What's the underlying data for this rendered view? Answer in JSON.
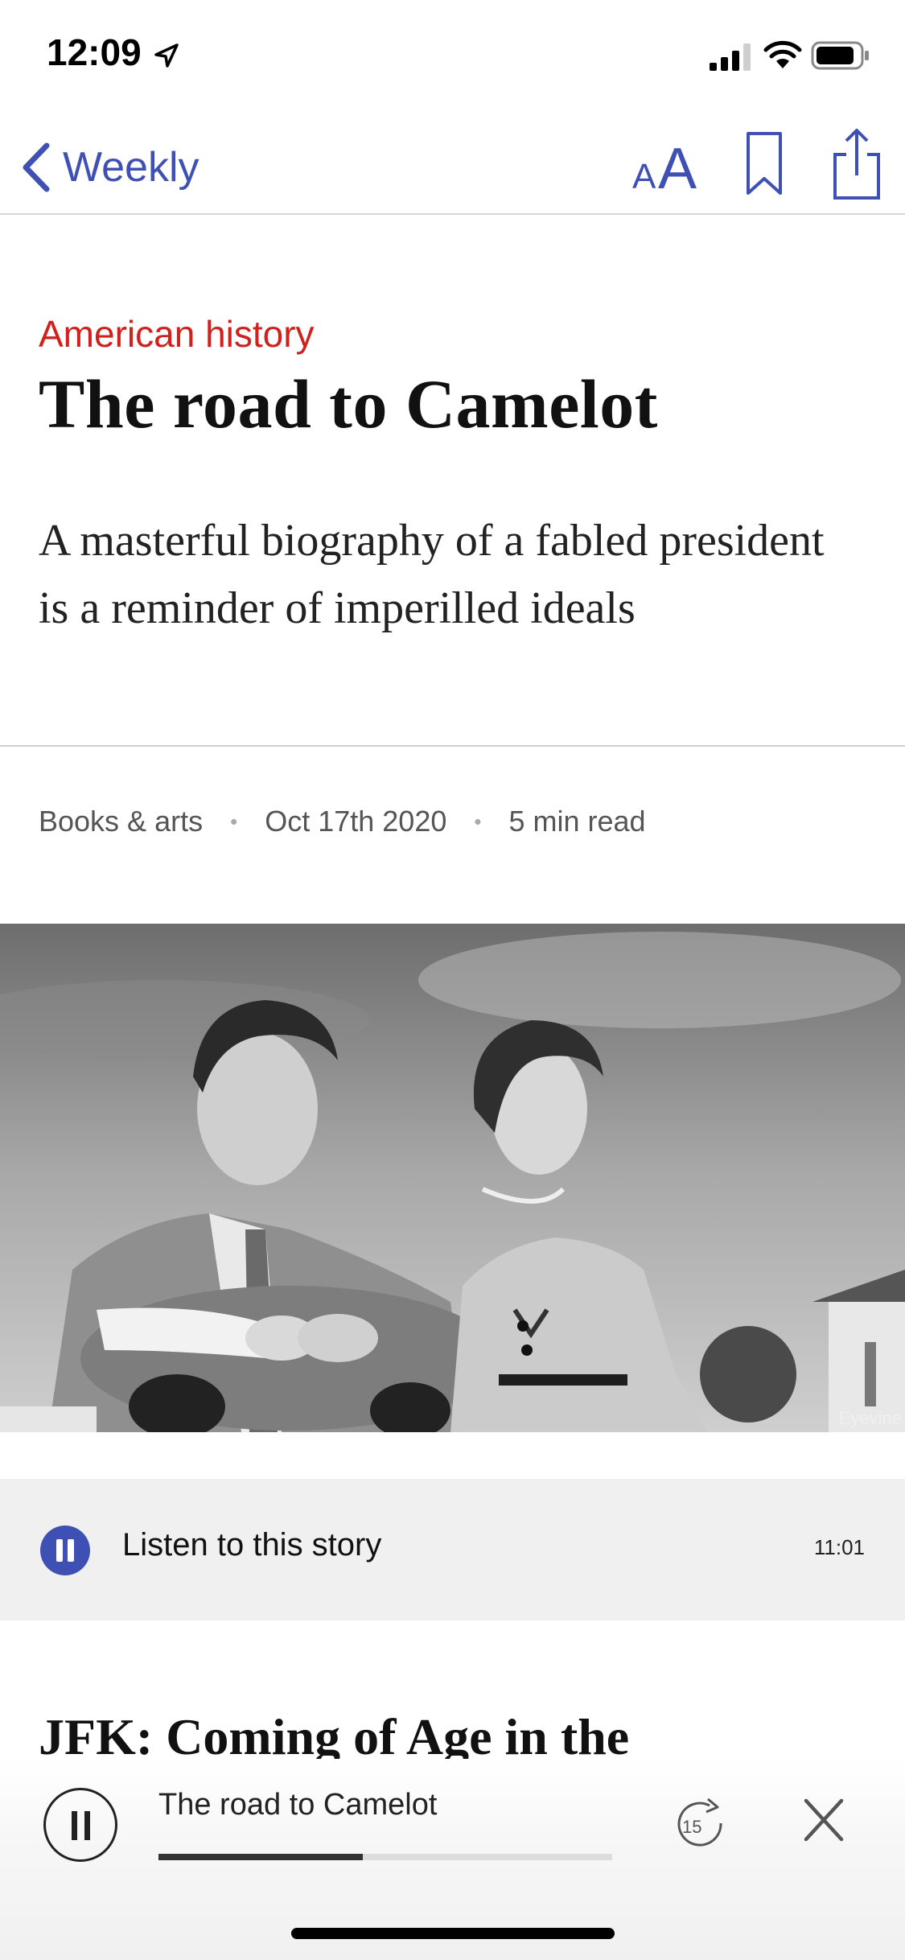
{
  "status_bar": {
    "time": "12:09"
  },
  "nav": {
    "back_label": "Weekly",
    "text_size_label": "AA"
  },
  "article": {
    "category": "American history",
    "headline": "The road to Camelot",
    "subhead": "A masterful biography of a fabled president is a reminder of imperilled ideals",
    "section": "Books & arts",
    "date": "Oct 17th 2020",
    "read_time": "5 min read",
    "photo_credit": "Eyevine",
    "book_title": "JFK: Coming of Age in the"
  },
  "listen": {
    "label": "Listen to this story",
    "duration": "11:01"
  },
  "mini_player": {
    "title": "The road to Camelot",
    "progress": 0.45,
    "skip_label": "15"
  },
  "colors": {
    "accent": "#3e50b4",
    "category_red": "#d0211c"
  }
}
